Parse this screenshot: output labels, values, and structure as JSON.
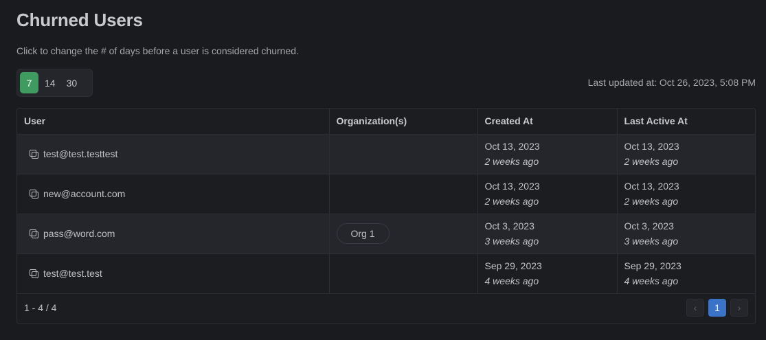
{
  "title": "Churned Users",
  "subtitle": "Click to change the # of days before a user is considered churned.",
  "days_options": [
    "7",
    "14",
    "30"
  ],
  "days_selected": "7",
  "last_updated": "Last updated at: Oct 26, 2023, 5:08 PM",
  "columns": [
    "User",
    "Organization(s)",
    "Created At",
    "Last Active At"
  ],
  "rows": [
    {
      "user": "test@test.testtest",
      "org": "",
      "created_date": "Oct 13, 2023",
      "created_ago": "2 weeks ago",
      "active_date": "Oct 13, 2023",
      "active_ago": "2 weeks ago"
    },
    {
      "user": "new@account.com",
      "org": "",
      "created_date": "Oct 13, 2023",
      "created_ago": "2 weeks ago",
      "active_date": "Oct 13, 2023",
      "active_ago": "2 weeks ago"
    },
    {
      "user": "pass@word.com",
      "org": "Org 1",
      "created_date": "Oct 3, 2023",
      "created_ago": "3 weeks ago",
      "active_date": "Oct 3, 2023",
      "active_ago": "3 weeks ago"
    },
    {
      "user": "test@test.test",
      "org": "",
      "created_date": "Sep 29, 2023",
      "created_ago": "4 weeks ago",
      "active_date": "Sep 29, 2023",
      "active_ago": "4 weeks ago"
    }
  ],
  "pagination": {
    "range": "1 - 4 / 4",
    "prev": "‹",
    "current": "1",
    "next": "›"
  },
  "colors": {
    "background": "#1a1b1e",
    "active_segment": "#3f9b5f",
    "active_page": "#3b73c8"
  },
  "icons": {
    "copy": "copy-icon"
  }
}
